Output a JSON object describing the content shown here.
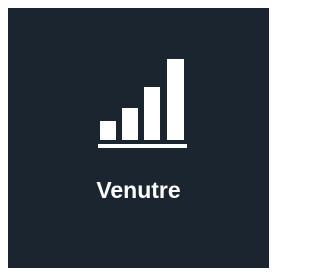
{
  "app": {
    "label": "Venutre",
    "icon": "bar-chart-icon",
    "colors": {
      "tile_background": "#1b2530",
      "page_background": "#ffffff",
      "foreground": "#ffffff"
    }
  }
}
